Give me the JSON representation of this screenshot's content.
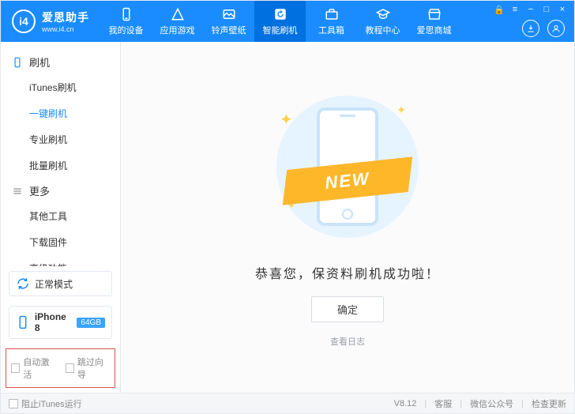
{
  "logo": {
    "mark": "i4",
    "cn": "爱思助手",
    "en": "www.i4.cn"
  },
  "nav": {
    "items": [
      {
        "label": "我的设备"
      },
      {
        "label": "应用游戏"
      },
      {
        "label": "铃声壁纸"
      },
      {
        "label": "智能刷机"
      },
      {
        "label": "工具箱"
      },
      {
        "label": "教程中心"
      },
      {
        "label": "爱思商城"
      }
    ]
  },
  "sidebar": {
    "flash": {
      "title": "刷机",
      "items": [
        {
          "label": "iTunes刷机"
        },
        {
          "label": "一键刷机"
        },
        {
          "label": "专业刷机"
        },
        {
          "label": "批量刷机"
        }
      ]
    },
    "more": {
      "title": "更多",
      "items": [
        {
          "label": "其他工具"
        },
        {
          "label": "下载固件"
        },
        {
          "label": "高级功能"
        }
      ]
    },
    "mode": {
      "label": "正常模式"
    },
    "device": {
      "name": "iPhone 8",
      "storage": "64GB"
    },
    "bottom": {
      "auto_activate": "自动激活",
      "skip_guide": "跳过向导"
    }
  },
  "main": {
    "ribbon": "NEW",
    "success": "恭喜您，保资料刷机成功啦！",
    "ok": "确定",
    "log": "查看日志"
  },
  "footer": {
    "block_itunes": "阻止iTunes运行",
    "version": "V8.12",
    "support": "客服",
    "wechat": "微信公众号",
    "update": "检查更新"
  }
}
